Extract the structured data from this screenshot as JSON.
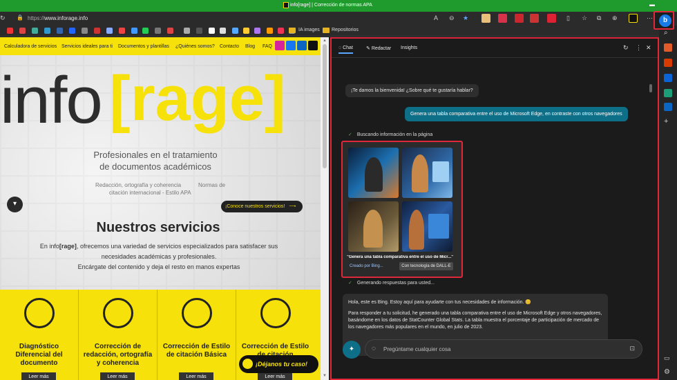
{
  "window": {
    "title": "info[rage] | Corrección de normas APA"
  },
  "addressbar": {
    "url_scheme": "https://",
    "url_host": "www.inforage.info"
  },
  "favorites": {
    "folder1": "IA images",
    "folder2": "Repositorios"
  },
  "site": {
    "nav": [
      "Calculadora de servicios",
      "Servicios ideales para ti",
      "Documentos y plantillas",
      "¿Quiénes somos?",
      "Contacto",
      "Blog",
      "FAQ"
    ],
    "logo_info": "info",
    "logo_rage": "[rage]",
    "tagline1": "Profesionales en el tratamiento",
    "tagline2": "de documentos académicos",
    "sub1": "Redacción, ortografía y coherencia",
    "sub2": "citación internacional - Estilo APA",
    "sub3": "Normas de",
    "cta": "¡Conoce nuestros servicios!",
    "services_heading": "Nuestros servicios",
    "intro_prefix": "En info",
    "intro_brand": "[rage]",
    "intro_rest": ", ofrecemos una variedad de servicios especializados para satisfacer sus",
    "intro_line2": "necesidades académicas y profesionales.",
    "intro_line3": "Encárgate del contenido y deja el resto en manos expertas",
    "cards": [
      {
        "title": "Diagnóstico Diferencial del documento",
        "more": "Leer más"
      },
      {
        "title": "Corrección de redacción, ortografía y coherencia",
        "more": "Leer más"
      },
      {
        "title": "Corrección de Estilo de citación Básica",
        "more": "Leer más"
      },
      {
        "title": "Corrección de Estilo de citación",
        "more": "Leer más"
      }
    ],
    "case_button": "¡Déjanos tu caso!"
  },
  "copilot": {
    "tabs": [
      "Chat",
      "Redactar",
      "Insights"
    ],
    "welcome": "¡Te damos la bienvenida! ¿Sobre qué te gustaría hablar?",
    "user_message": "Genera una tabla comparativa entre el uso de Microsoft Edge, en contraste con otros navegadores",
    "status_search": "Buscando información en la página",
    "image_prompt": "\"Genera una tabla comparativa entre el uso de Micr...\"",
    "image_by": "Creado por Bing...",
    "image_tech": "Con tecnología de DALL-E",
    "status_generating": "Generando respuestas para usted...",
    "response_p1": "Hola, este es Bing. Estoy aquí para ayudarte con tus necesidades de información. 😊",
    "response_p2": "Para responder a tu solicitud, he generado una tabla comparativa entre el uso de Microsoft Edge y otros navegadores, basándome en los datos de StatCounter Global Stats. La tabla muestra el porcentaje de participación de mercado de los navegadores más populares en el mundo, en julio de 2023.",
    "input_placeholder": "Pregúntame cualquier cosa"
  },
  "colors": {
    "brand_yellow": "#f6e10a",
    "highlight_red": "#e0283a",
    "copilot_teal": "#0e6f88",
    "title_green": "#1f9b2e"
  }
}
